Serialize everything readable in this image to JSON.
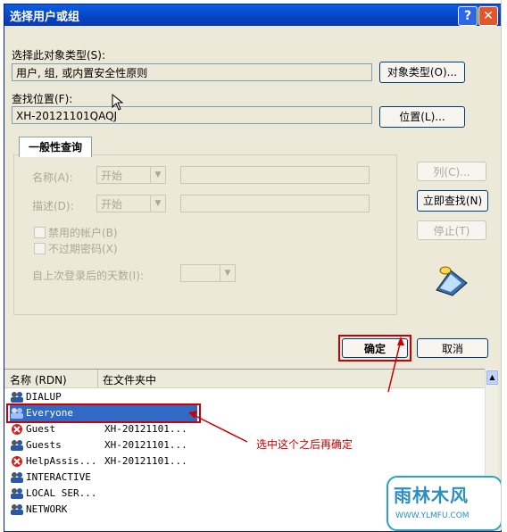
{
  "window": {
    "title": "选择用户或组",
    "help": "?",
    "close": "✕"
  },
  "object_type": {
    "label": "选择此对象类型(S):",
    "value": "用户, 组, 或内置安全性原则",
    "button": "对象类型(O)..."
  },
  "location": {
    "label": "查找位置(F):",
    "value": "XH-20121101QAQJ",
    "button": "位置(L)..."
  },
  "tab": {
    "label": "一般性查询"
  },
  "query": {
    "name_label": "名称(A):",
    "name_op": "开始",
    "desc_label": "描述(D):",
    "desc_op": "开始",
    "disabled_accounts": "禁用的帐户(B)",
    "no_expire_pwd": "不过期密码(X)",
    "days_since_logon": "自上次登录后的天数(I):"
  },
  "buttons": {
    "columns": "列(C)...",
    "find_now": "立即查找(N)",
    "stop": "停止(T)",
    "ok": "确定",
    "cancel": "取消"
  },
  "results": {
    "header_name": "名称 (RDN)",
    "header_folder": "在文件夹中",
    "rows": [
      {
        "name": "DIALUP",
        "folder": ""
      },
      {
        "name": "Everyone",
        "folder": ""
      },
      {
        "name": "Guest",
        "folder": "XH-20121101..."
      },
      {
        "name": "Guests",
        "folder": "XH-20121101..."
      },
      {
        "name": "HelpAssis...",
        "folder": "XH-20121101..."
      },
      {
        "name": "INTERACTIVE",
        "folder": ""
      },
      {
        "name": "LOCAL SER...",
        "folder": ""
      },
      {
        "name": "NETWORK",
        "folder": ""
      }
    ]
  },
  "annotation": {
    "text": "选中这个之后再确定",
    "color": "#cc0000"
  },
  "watermark": {
    "brand": "雨林木风",
    "url": "WWW.YLMFU.COM"
  }
}
